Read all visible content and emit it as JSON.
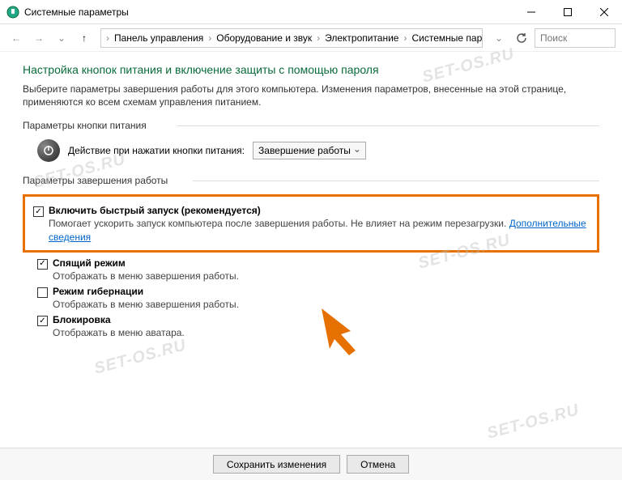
{
  "window": {
    "title": "Системные параметры"
  },
  "breadcrumb": {
    "items": [
      "Панель управления",
      "Оборудование и звук",
      "Электропитание",
      "Системные параметры"
    ]
  },
  "search": {
    "placeholder": "Поиск"
  },
  "page": {
    "heading": "Настройка кнопок питания и включение защиты с помощью пароля",
    "subtext": "Выберите параметры завершения работы для этого компьютера. Изменения параметров, внесенные на этой странице, применяются ко всем схемам управления питанием."
  },
  "power_button": {
    "section_label": "Параметры кнопки питания",
    "action_label": "Действие при нажатии кнопки питания:",
    "selected": "Завершение работы"
  },
  "shutdown": {
    "section_label": "Параметры завершения работы",
    "options": [
      {
        "label": "Включить быстрый запуск (рекомендуется)",
        "desc_pre": "Помогает ускорить запуск компьютера после завершения работы. Не влияет на режим перезагрузки. ",
        "link": "Дополнительные сведения",
        "checked": true
      },
      {
        "label": "Спящий режим",
        "desc": "Отображать в меню завершения работы.",
        "checked": true
      },
      {
        "label": "Режим гибернации",
        "desc": "Отображать в меню завершения работы.",
        "checked": false
      },
      {
        "label": "Блокировка",
        "desc": "Отображать в меню аватара.",
        "checked": true
      }
    ]
  },
  "footer": {
    "save": "Сохранить изменения",
    "cancel": "Отмена"
  },
  "watermark": "SET-OS.RU"
}
